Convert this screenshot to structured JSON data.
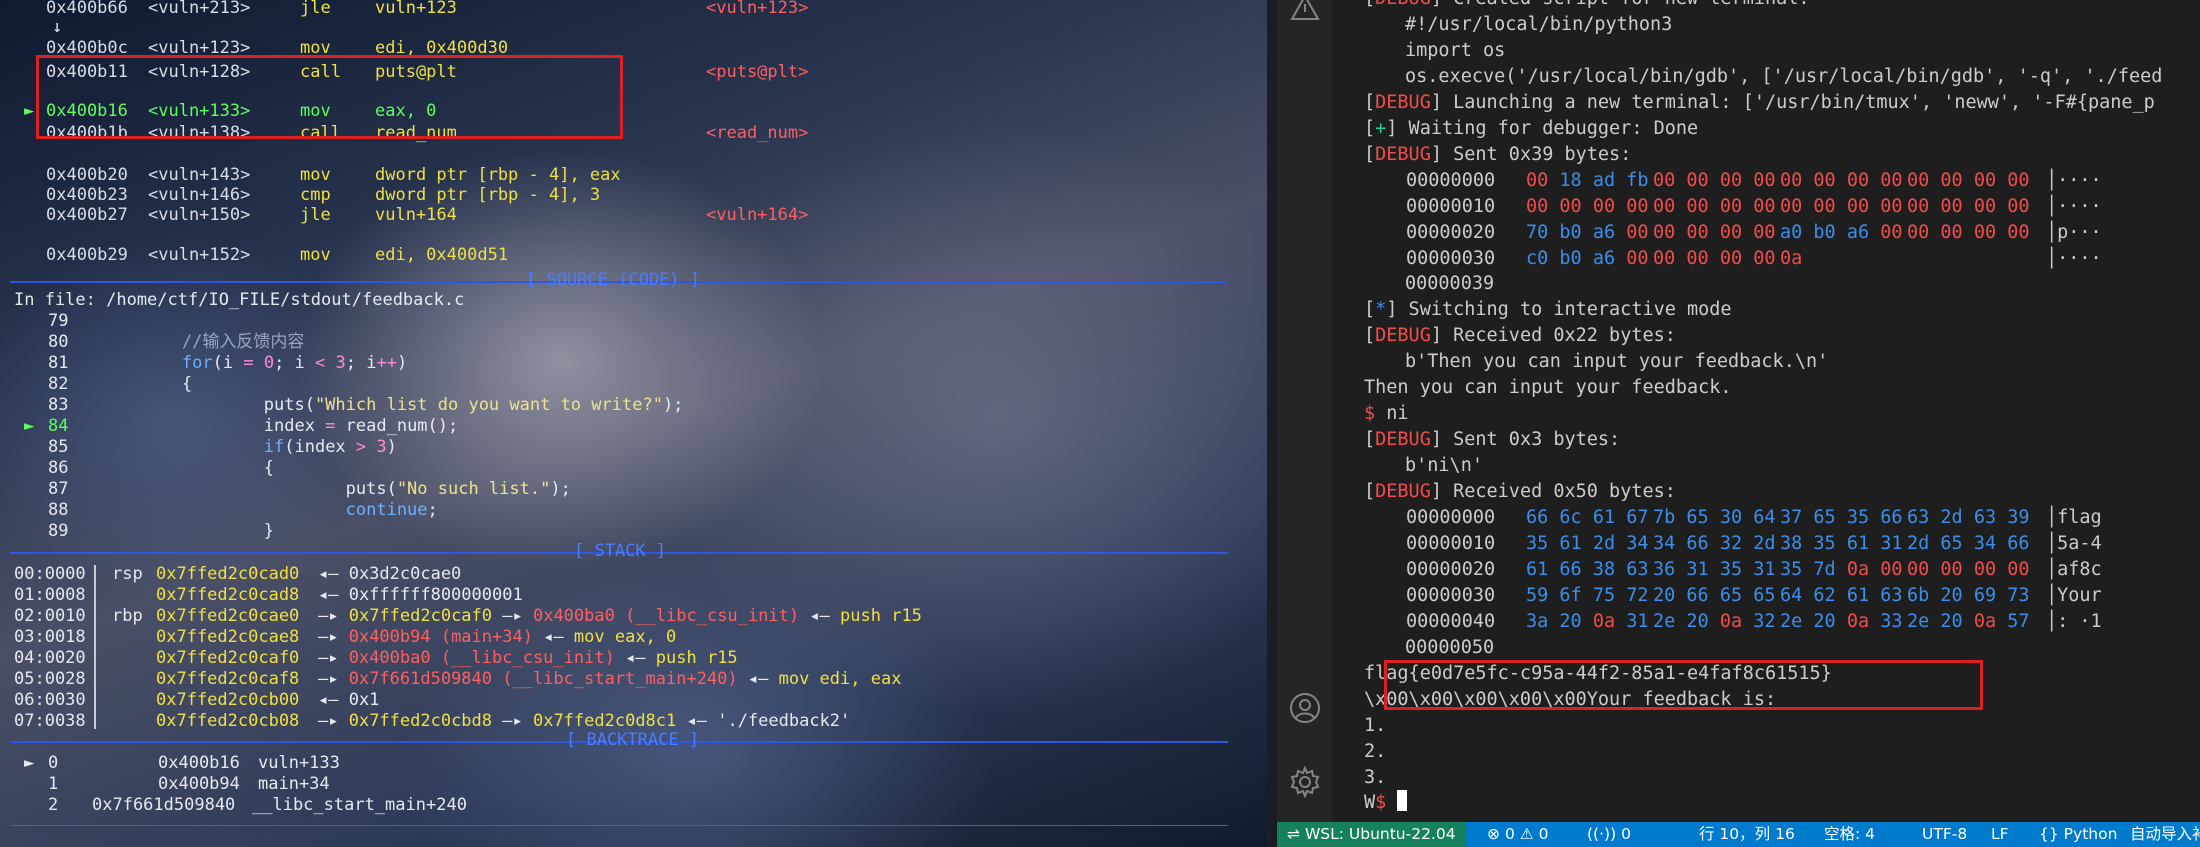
{
  "gdb": {
    "code_lines": [
      {
        "addr": "0x400b66",
        "sym": "<vuln+213>",
        "mnem": "jle",
        "ops": "vuln+123",
        "target": "<vuln+123>"
      },
      {
        "arrow": "↓"
      },
      {
        "addr": "0x400b0c",
        "sym": "<vuln+123>",
        "mnem": "mov",
        "ops": "edi, 0x400d30",
        "target": ""
      },
      {
        "addr": "0x400b11",
        "sym": "<vuln+128>",
        "mnem": "call",
        "ops": "puts@plt",
        "target": "<puts@plt>"
      },
      {
        "marker": "►",
        "addr": "0x400b16",
        "sym": "<vuln+133>",
        "mnem": "mov",
        "ops": "eax, 0",
        "target": ""
      },
      {
        "addr": "0x400b1b",
        "sym": "<vuln+138>",
        "mnem": "call",
        "ops": "read_num",
        "target": "<read_num>"
      },
      {
        "addr": "0x400b20",
        "sym": "<vuln+143>",
        "mnem": "mov",
        "ops": "dword ptr [rbp - 4], eax",
        "target": ""
      },
      {
        "addr": "0x400b23",
        "sym": "<vuln+146>",
        "mnem": "cmp",
        "ops": "dword ptr [rbp - 4], 3",
        "target": ""
      },
      {
        "addr": "0x400b27",
        "sym": "<vuln+150>",
        "mnem": "jle",
        "ops": "vuln+164",
        "target": "<vuln+164>"
      },
      {
        "addr": "0x400b29",
        "sym": "<vuln+152>",
        "mnem": "mov",
        "ops": "edi, 0x400d51",
        "target": ""
      }
    ],
    "source_banner": "[ SOURCE (CODE) ]",
    "source_file": "In file: /home/ctf/IO_FILE/stdout/feedback.c",
    "source_lines": [
      {
        "num": "79",
        "text": ""
      },
      {
        "num": "80",
        "text": "        //输入反馈内容"
      },
      {
        "num": "81",
        "text": "        for(i = 0; i < 3; i++)"
      },
      {
        "num": "82",
        "text": "        {"
      },
      {
        "num": "83",
        "text": "                puts(\"Which list do you want to write?\");"
      },
      {
        "num": "84",
        "marker": "►",
        "text": "                index = read_num();"
      },
      {
        "num": "85",
        "text": "                if(index > 3)"
      },
      {
        "num": "86",
        "text": "                {"
      },
      {
        "num": "87",
        "text": "                        puts(\"No such list.\");"
      },
      {
        "num": "88",
        "text": "                        continue;"
      },
      {
        "num": "89",
        "text": "                }"
      }
    ],
    "stack_banner": "[ STACK ]",
    "stack_lines": [
      {
        "idx": "00:0000",
        "reg": "rsp",
        "addr": "0x7ffed2c0cad0",
        "rest": "◂— 0x3d2c0cae0"
      },
      {
        "idx": "01:0008",
        "reg": "",
        "addr": "0x7ffed2c0cad8",
        "rest": "◂— 0xffffff800000001"
      },
      {
        "idx": "02:0010",
        "reg": "rbp",
        "addr": "0x7ffed2c0cae0",
        "rest": "—▸ 0x7ffed2c0caf0 —▸ 0x400ba0 (__libc_csu_init) ◂— push r15"
      },
      {
        "idx": "03:0018",
        "reg": "",
        "addr": "0x7ffed2c0cae8",
        "rest": "—▸ 0x400b94 (main+34) ◂— mov eax, 0"
      },
      {
        "idx": "04:0020",
        "reg": "",
        "addr": "0x7ffed2c0caf0",
        "rest": "—▸ 0x400ba0 (__libc_csu_init) ◂— push r15"
      },
      {
        "idx": "05:0028",
        "reg": "",
        "addr": "0x7ffed2c0caf8",
        "rest": "—▸ 0x7f661d509840 (__libc_start_main+240) ◂— mov edi, eax"
      },
      {
        "idx": "06:0030",
        "reg": "",
        "addr": "0x7ffed2c0cb00",
        "rest": "◂— 0x1"
      },
      {
        "idx": "07:0038",
        "reg": "",
        "addr": "0x7ffed2c0cb08",
        "rest": "—▸ 0x7ffed2c0cbd8 —▸ 0x7ffed2c0d8c1 ◂— './feedback2'"
      }
    ],
    "backtrace_banner": "[ BACKTRACE ]",
    "backtrace_lines": [
      {
        "marker": "►",
        "num": "0",
        "addr": "0x400b16",
        "sym": "vuln+133"
      },
      {
        "marker": "",
        "num": "1",
        "addr": "0x400b94",
        "sym": "main+34"
      },
      {
        "marker": "",
        "num": "2",
        "addr": "0x7f661d509840",
        "sym": "__libc_start_main+240"
      }
    ]
  },
  "terminal": {
    "lines": [
      {
        "tag": "DEBUG",
        "text": " Created script for new terminal:"
      },
      {
        "indent": true,
        "text": "#!/usr/local/bin/python3"
      },
      {
        "indent": true,
        "text": "import os"
      },
      {
        "indent": true,
        "text": "os.execve('/usr/local/bin/gdb', ['/usr/local/bin/gdb', '-q', './feed"
      },
      {
        "tag": "DEBUG",
        "text": " Launching a new terminal: ['/usr/bin/tmux', 'neww', '-F#{pane_p"
      },
      {
        "tag": "+",
        "text": " Waiting for debugger: Done"
      },
      {
        "tag": "DEBUG",
        "text": " Sent 0x39 bytes:"
      },
      {
        "hex": [
          "00000000",
          "00 18 ad fb",
          "00 00 00 00",
          "00 00 00 00",
          "00 00 00 00",
          "│····"
        ]
      },
      {
        "hex": [
          "00000010",
          "00 00 00 00",
          "00 00 00 00",
          "00 00 00 00",
          "00 00 00 00",
          "│····"
        ]
      },
      {
        "hex": [
          "00000020",
          "70 b0 a6 00",
          "00 00 00 00",
          "a0 b0 a6 00",
          "00 00 00 00",
          "│p···"
        ]
      },
      {
        "hex": [
          "00000030",
          "c0 b0 a6 00",
          "00 00 00 00",
          "0a",
          "",
          "│····"
        ]
      },
      {
        "indent": true,
        "text": "00000039"
      },
      {
        "tag": "*",
        "text": " Switching to interactive mode"
      },
      {
        "tag": "DEBUG",
        "text": " Received 0x22 bytes:"
      },
      {
        "indent": true,
        "text": "b'Then you can input your feedback.\\n'"
      },
      {
        "text": "Then you can input your feedback."
      },
      {
        "prompt": "$",
        "text": " ni"
      },
      {
        "tag": "DEBUG",
        "text": " Sent 0x3 bytes:"
      },
      {
        "indent": true,
        "text": "b'ni\\n'"
      },
      {
        "tag": "DEBUG",
        "text": " Received 0x50 bytes:"
      },
      {
        "hex": [
          "00000000",
          "66 6c 61 67",
          "7b 65 30 64",
          "37 65 35 66",
          "63 2d 63 39",
          "│flag"
        ]
      },
      {
        "hex": [
          "00000010",
          "35 61 2d 34",
          "34 66 32 2d",
          "38 35 61 31",
          "2d 65 34 66",
          "│5a-4"
        ]
      },
      {
        "hex": [
          "00000020",
          "61 66 38 63",
          "36 31 35 31",
          "35 7d 0a 00",
          "00 00 00 00",
          "│af8c"
        ]
      },
      {
        "hex": [
          "00000030",
          "59 6f 75 72",
          "20 66 65 65",
          "64 62 61 63",
          "6b 20 69 73",
          "│Your"
        ]
      },
      {
        "hex": [
          "00000040",
          "3a 20 0a 31",
          "2e 20 0a 32",
          "2e 20 0a 33",
          "2e 20 0a 57",
          "│: ·1"
        ]
      },
      {
        "indent": true,
        "text": "00000050"
      },
      {
        "text": "flag{e0d7e5fc-c95a-44f2-85a1-e4faf8c61515}"
      },
      {
        "text": "\\x00\\x00\\x00\\x00\\x00Your feedback is:"
      },
      {
        "text": "1."
      },
      {
        "text": "2."
      },
      {
        "text": "3."
      },
      {
        "text": "W$ ",
        "cursor": true
      }
    ]
  },
  "status_bar": {
    "remote": "WSL: Ubuntu-22.04",
    "errors": "0",
    "warnings": "0",
    "ports": "0",
    "position": "行 10，列 16",
    "spaces": "空格: 4",
    "encoding": "UTF-8",
    "eol": "LF",
    "language": "Python",
    "extra": "自动导入补全"
  },
  "colors": {
    "status_bar": "#007acc",
    "remote": "#16825d",
    "highlight_box": "#e02020",
    "debug_tag": "#f14c4c",
    "banner": "#2f56e0"
  },
  "icons": [
    "warning-icon",
    "account-icon",
    "settings-icon",
    "remote-icon",
    "error-icon",
    "port-icon"
  ]
}
